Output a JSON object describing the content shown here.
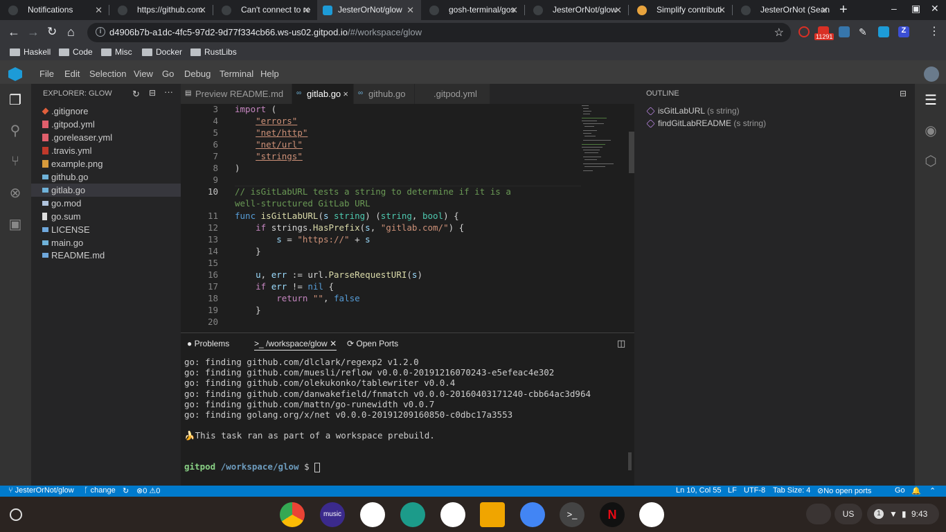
{
  "browser": {
    "tabs": [
      {
        "title": "Notifications",
        "active": false
      },
      {
        "title": "https://github.com",
        "active": false
      },
      {
        "title": "Can't connect to re",
        "active": false
      },
      {
        "title": "JesterOrNot/glow",
        "active": true
      },
      {
        "title": "gosh-terminal/gos",
        "active": false
      },
      {
        "title": "JesterOrNot/glow",
        "active": false
      },
      {
        "title": "Simplify contributi",
        "active": false
      },
      {
        "title": "JesterOrNot (Sean",
        "active": false
      }
    ],
    "url_host": "d4906b7b-a1dc-4fc5-97d2-9d77f334cb66.ws-us02.gitpod.io",
    "url_path": "/#/workspace/glow",
    "ext_badge": "11291",
    "bookmarks": [
      "Haskell",
      "Code",
      "Misc",
      "Docker",
      "RustLibs"
    ]
  },
  "vscode": {
    "menu": [
      "File",
      "Edit",
      "Selection",
      "View",
      "Go",
      "Debug",
      "Terminal",
      "Help"
    ],
    "explorer_title": "EXPLORER: GLOW",
    "files": [
      {
        "name": ".gitignore",
        "color": "#e05f3c",
        "selected": false
      },
      {
        "name": ".gitpod.yml",
        "color": "#e05f6c",
        "selected": false
      },
      {
        "name": ".goreleaser.yml",
        "color": "#e05f6c",
        "selected": false
      },
      {
        "name": ".travis.yml",
        "color": "#c0392b",
        "selected": false
      },
      {
        "name": "example.png",
        "color": "#d89b3c",
        "selected": false
      },
      {
        "name": "github.go",
        "color": "#6fb2d9",
        "selected": false
      },
      {
        "name": "gitlab.go",
        "color": "#6fb2d9",
        "selected": true
      },
      {
        "name": "go.mod",
        "color": "#b0c4de",
        "selected": false
      },
      {
        "name": "go.sum",
        "color": "#dddddd",
        "selected": false
      },
      {
        "name": "LICENSE",
        "color": "#6fa8dc",
        "selected": false
      },
      {
        "name": "main.go",
        "color": "#6fb2d9",
        "selected": false
      },
      {
        "name": "README.md",
        "color": "#6fa8dc",
        "selected": false
      }
    ],
    "editor_tabs": [
      {
        "label": "Preview README.md",
        "icon": "▤",
        "active": false
      },
      {
        "label": "gitlab.go",
        "icon": "∞",
        "active": true,
        "close": "×"
      },
      {
        "label": "github.go",
        "icon": "∞",
        "active": false
      },
      {
        "label": ".gitpod.yml",
        "icon": "",
        "active": false
      }
    ],
    "line_numbers": [
      "3",
      "4",
      "5",
      "6",
      "7",
      "8",
      "9",
      "10",
      "",
      "11",
      "12",
      "13",
      "14",
      "15",
      "16",
      "17",
      "18",
      "19",
      "20"
    ],
    "code_tokens": {
      "import": "import",
      "errors": "\"errors\"",
      "nethttp": "\"net/http\"",
      "neturl": "\"net/url\"",
      "strings": "\"strings\"",
      "comment1": "// isGitLabURL tests a string to determine if it is a",
      "comment2": "well-structured GitLab URL",
      "func_sig": "isGitLabURL",
      "hasprefix": "HasPrefix",
      "gitlabcom": "\"gitlab.com/\"",
      "https": "\"https://\"",
      "parse": "ParseRequestURI",
      "empty": "\"\"",
      "false": "false",
      "nil": "nil",
      "return": "return"
    },
    "panel_tabs": {
      "problems": "Problems",
      "terminal": ">_ /workspace/glow",
      "ports": "Open Ports"
    },
    "terminal_lines": [
      "go: finding github.com/dlclark/regexp2 v1.2.0",
      "go: finding github.com/muesli/reflow v0.0.0-20191216070243-e5efeac4e302",
      "go: finding github.com/olekukonko/tablewriter v0.0.4",
      "go: finding github.com/danwakefield/fnmatch v0.0.0-20160403171240-cbb64ac3d964",
      "go: finding github.com/mattn/go-runewidth v0.0.7",
      "go: finding golang.org/x/net v0.0.0-20191209160850-c0dbc17a3553",
      "",
      "🍌This task ran as part of a workspace prebuild."
    ],
    "prompt_user": "gitpod",
    "prompt_dir": "/workspace/glow",
    "prompt_sym": "$",
    "outline_title": "OUTLINE",
    "outline": [
      {
        "name": "isGitLabURL",
        "sig": "(s string)"
      },
      {
        "name": "findGitLabREADME",
        "sig": "(s string)"
      }
    ],
    "status": {
      "repo": "JesterOrNot/glow",
      "branch": "change",
      "errors": "0",
      "warnings": "0",
      "position": "Ln 10, Col 55",
      "eol": "LF",
      "encoding": "UTF-8",
      "tabsize": "Tab Size: 4",
      "ports": "No open ports",
      "lang": "Go"
    }
  },
  "shelf": {
    "locale": "US",
    "notif_count": "1",
    "time": "9:43",
    "music_label": "music"
  }
}
